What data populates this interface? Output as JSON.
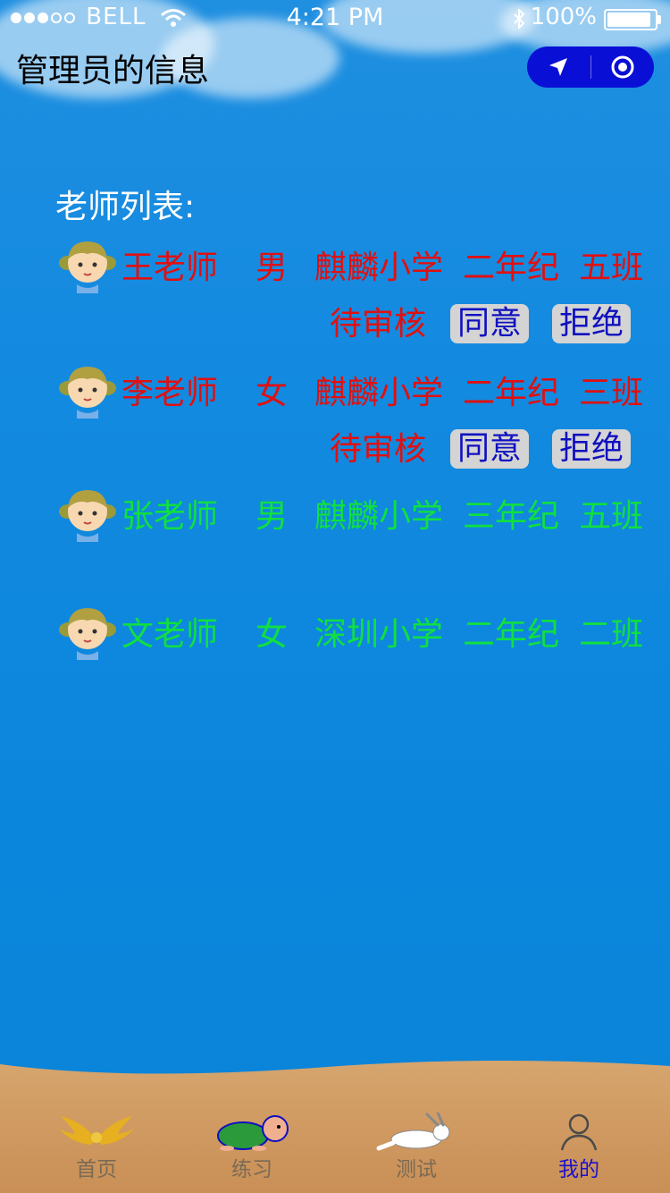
{
  "status_bar": {
    "carrier": "BELL",
    "signal_bars_filled": 3,
    "signal_bars_total": 5,
    "time": "4:21 PM",
    "battery": "100%",
    "battery_level": 1.0
  },
  "nav": {
    "title": "管理员的信息",
    "capsule_icons": [
      "location-arrow-icon",
      "record-target-icon"
    ],
    "capsule_color": "#0a0fd6"
  },
  "section_title": "老师列表:",
  "teachers": [
    {
      "name": "王老师",
      "gender": "男",
      "school": "麒麟小学",
      "grade": "二年纪",
      "class": "五班",
      "color": "red",
      "pending": true,
      "status": "待审核",
      "approve": "同意",
      "reject": "拒绝"
    },
    {
      "name": "李老师",
      "gender": "女",
      "school": "麒麟小学",
      "grade": "二年纪",
      "class": "三班",
      "color": "red",
      "pending": true,
      "status": "待审核",
      "approve": "同意",
      "reject": "拒绝"
    },
    {
      "name": "张老师",
      "gender": "男",
      "school": "麒麟小学",
      "grade": "三年纪",
      "class": "五班",
      "color": "green",
      "pending": false
    },
    {
      "name": "文老师",
      "gender": "女",
      "school": "深圳小学",
      "grade": "二年纪",
      "class": "二班",
      "color": "green",
      "pending": false
    }
  ],
  "colors": {
    "pending": "#e01010",
    "approved": "#10e040",
    "button_text": "#1010c0",
    "button_bg": "#d4d4d4"
  },
  "tabbar": [
    {
      "label": "首页",
      "icon": "golden-wings-icon",
      "active": false
    },
    {
      "label": "练习",
      "icon": "turtle-icon",
      "active": false
    },
    {
      "label": "测试",
      "icon": "rabbit-icon",
      "active": false
    },
    {
      "label": "我的",
      "icon": "user-icon",
      "active": true
    }
  ]
}
